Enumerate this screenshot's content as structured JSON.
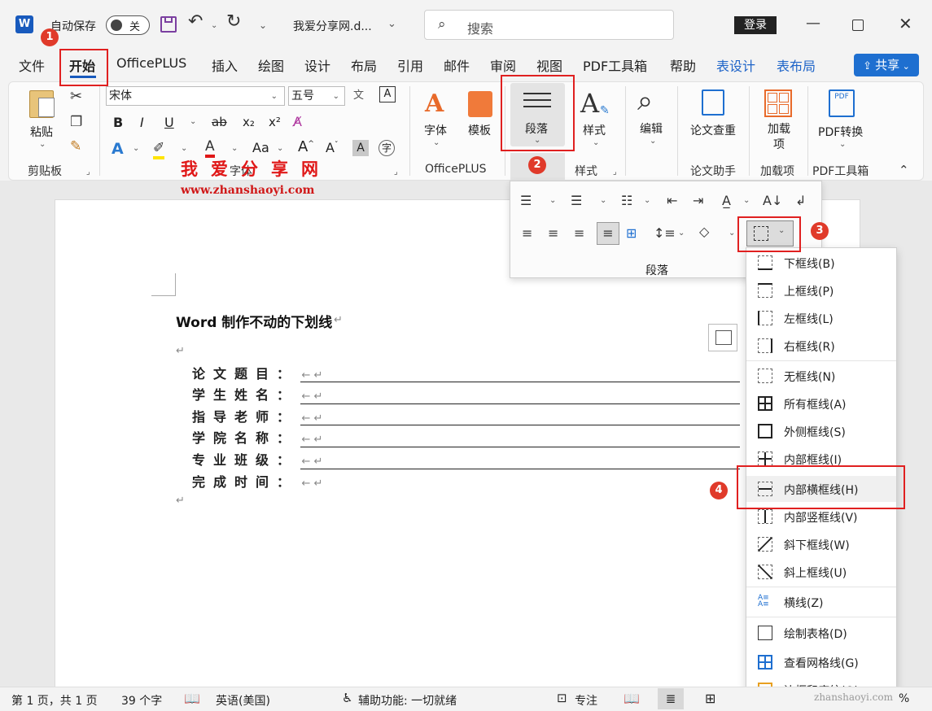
{
  "titlebar": {
    "autosave_label": "自动保存",
    "autosave_state": "关",
    "doc_title": "我爱分享网.d...",
    "search_placeholder": "搜索",
    "login_label": "登录"
  },
  "menu": {
    "tabs": [
      "文件",
      "开始",
      "OfficePLUS",
      "插入",
      "绘图",
      "设计",
      "布局",
      "引用",
      "邮件",
      "审阅",
      "视图",
      "PDF工具箱",
      "帮助",
      "表设计",
      "表布局"
    ],
    "share_label": "共享"
  },
  "ribbon": {
    "paste_label": "粘贴",
    "clipboard_group": "剪贴板",
    "font_name": "宋体",
    "font_size": "五号",
    "font_group": "字体",
    "font_btn": "字体",
    "template_btn": "模板",
    "officeplus_group": "OfficePLUS",
    "paragraph_btn": "段落",
    "styles_btn": "样式",
    "styles_group": "样式",
    "edit_btn": "编辑",
    "thesis_btn": "论文查重",
    "thesis_group": "论文助手",
    "addin_btn": "加载项",
    "addin_group": "加载项",
    "pdf_btn": "PDF转换",
    "pdf_group": "PDF工具箱"
  },
  "paragraph_popup": {
    "group_label": "段落"
  },
  "border_menu": {
    "items": [
      "下框线(B)",
      "上框线(P)",
      "左框线(L)",
      "右框线(R)",
      "无框线(N)",
      "所有框线(A)",
      "外侧框线(S)",
      "内部框线(I)",
      "内部横框线(H)",
      "内部竖框线(V)",
      "斜下框线(W)",
      "斜上框线(U)",
      "横线(Z)",
      "绘制表格(D)",
      "查看网格线(G)",
      "边框和底纹(O)..."
    ]
  },
  "document": {
    "heading": "Word 制作不动的下划线",
    "fields": [
      "论文题目：",
      "学生姓名：",
      "指导老师：",
      "学院名称：",
      "专业班级：",
      "完成时间："
    ]
  },
  "annotations": {
    "badges": [
      "1",
      "2",
      "3",
      "4"
    ],
    "watermark": "我爱分享网",
    "watermark_url": "www.zhanshaoyi.com",
    "corner_watermark": "zhanshaoyi.com"
  },
  "statusbar": {
    "page_info": "第 1 页，共 1 页",
    "word_count": "39 个字",
    "language": "英语(美国)",
    "accessibility": "辅助功能: 一切就绪",
    "focus": "专注",
    "zoom": "%"
  },
  "colors": {
    "accent": "#1e6fd0",
    "annotation_red": "#e02020",
    "word_blue": "#185abd"
  }
}
